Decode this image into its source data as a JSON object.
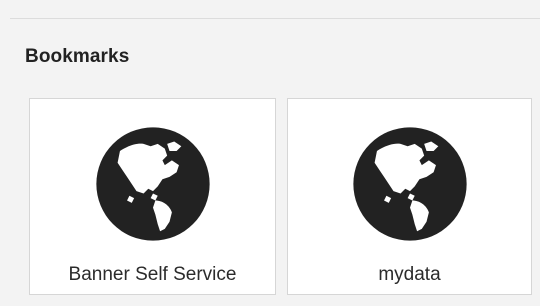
{
  "section": {
    "title": "Bookmarks"
  },
  "bookmarks": [
    {
      "label": "Banner Self Service",
      "icon": "globe-icon"
    },
    {
      "label": "mydata",
      "icon": "globe-icon"
    }
  ],
  "colors": {
    "background": "#f3f3f3",
    "card_background": "#ffffff",
    "card_border": "#d6d6d6",
    "globe": "#222222",
    "text": "#2b2b2b"
  }
}
